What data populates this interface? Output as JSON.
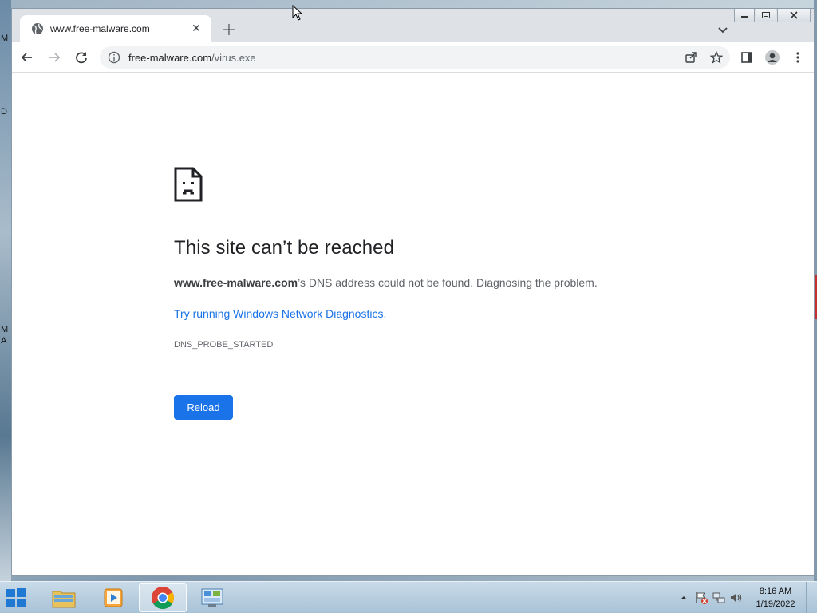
{
  "desktop": {
    "edge_letters": [
      "M",
      "D",
      "M",
      "A"
    ]
  },
  "browser": {
    "tab": {
      "title": "www.free-malware.com",
      "favicon": "globe-icon",
      "close_symbol": "✕"
    },
    "new_tab_symbol": "+",
    "address_bar": {
      "host": "free-malware.com",
      "path": "/virus.exe"
    }
  },
  "error_page": {
    "icon": "sad-document-icon",
    "title": "This site can’t be reached",
    "domain": "www.free-malware.com",
    "description_rest": "’s DNS address could not be found. Diagnosing the problem.",
    "link_text": "Try running Windows Network Diagnostics.",
    "error_code": "DNS_PROBE_STARTED",
    "reload_label": "Reload",
    "colors": {
      "accent": "#1a73e8",
      "title": "#202124",
      "text": "#5f6368"
    }
  },
  "taskbar": {
    "apps": [
      "windows-explorer-icon",
      "media-player-icon",
      "chrome-icon",
      "control-panel-icon"
    ],
    "clock": {
      "time": "8:16 AM",
      "date": "1/19/2022"
    }
  }
}
